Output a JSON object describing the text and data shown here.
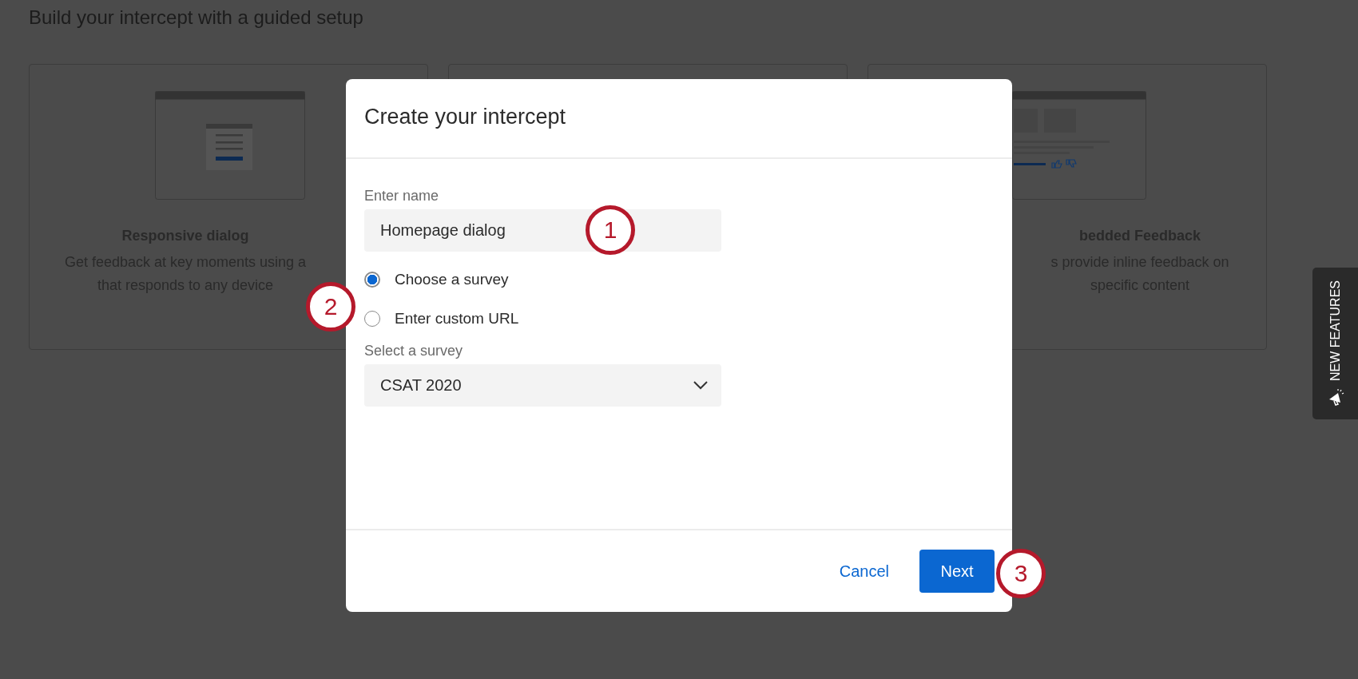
{
  "page": {
    "heading": "Build your intercept with a guided setup",
    "cards": [
      {
        "kind": "dialog",
        "title": "Responsive dialog",
        "lines": [
          "Get feedback at key moments using a",
          "that responds to any device"
        ]
      },
      {
        "kind": "covered"
      },
      {
        "kind": "embedded",
        "title": "bedded Feedback",
        "lines": [
          "s provide inline feedback on",
          "specific content"
        ]
      }
    ]
  },
  "dialog": {
    "title": "Create your intercept",
    "name_field": {
      "label": "Enter name",
      "value": "Homepage dialog"
    },
    "survey_source": [
      {
        "label": "Choose a survey",
        "selected": true
      },
      {
        "label": "Enter custom URL",
        "selected": false
      }
    ],
    "survey_select": {
      "label": "Select a survey",
      "value": "CSAT 2020"
    },
    "cancel_button": "Cancel",
    "next_button": "Next"
  },
  "callouts": [
    "1",
    "2",
    "3"
  ],
  "new_features_tab": {
    "label": "NEW FEATURES"
  }
}
